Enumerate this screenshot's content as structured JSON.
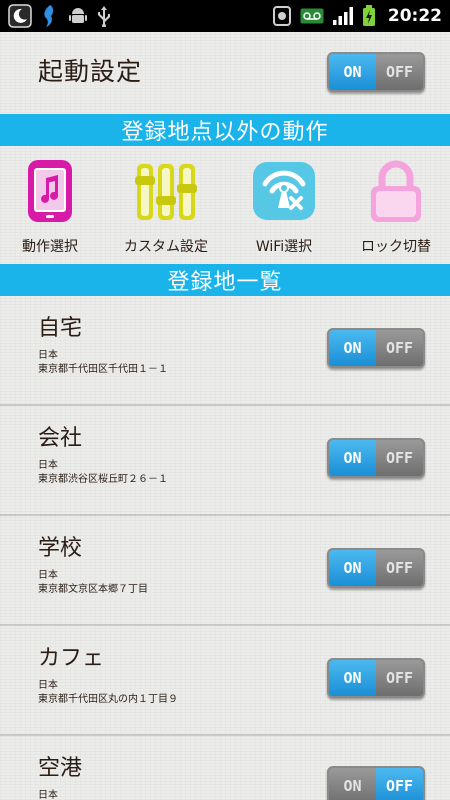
{
  "status_bar": {
    "time": "20:22",
    "left_icons": [
      "moon-app-icon",
      "bird-app-icon",
      "android-icon",
      "usb-icon"
    ],
    "right_icons": [
      "antivirus-icon",
      "voicemail-icon",
      "signal-icon",
      "battery-icon"
    ]
  },
  "startup": {
    "label": "起動設定",
    "toggle": {
      "on_label": "ON",
      "off_label": "OFF",
      "state": "on"
    }
  },
  "section_outside": {
    "title": "登録地点以外の動作"
  },
  "actions": [
    {
      "label": "動作選択",
      "icon": "phone-music-icon",
      "color": "#d81aa8"
    },
    {
      "label": "カスタム設定",
      "icon": "sliders-icon",
      "color": "#d8d81a"
    },
    {
      "label": "WiFi選択",
      "icon": "wifi-off-icon",
      "color": "#56c8e6"
    },
    {
      "label": "ロック切替",
      "icon": "lock-icon",
      "color": "#f5a3dc"
    }
  ],
  "section_list": {
    "title": "登録地一覧"
  },
  "locations": [
    {
      "name": "自宅",
      "country": "日本",
      "address": "東京都千代田区千代田１－１",
      "toggle": {
        "on_label": "ON",
        "off_label": "OFF",
        "state": "on"
      }
    },
    {
      "name": "会社",
      "country": "日本",
      "address": "東京都渋谷区桜丘町２６－１",
      "toggle": {
        "on_label": "ON",
        "off_label": "OFF",
        "state": "on"
      }
    },
    {
      "name": "学校",
      "country": "日本",
      "address": "東京都文京区本郷７丁目",
      "toggle": {
        "on_label": "ON",
        "off_label": "OFF",
        "state": "on"
      }
    },
    {
      "name": "カフェ",
      "country": "日本",
      "address": "東京都千代田区丸の内１丁目９",
      "toggle": {
        "on_label": "ON",
        "off_label": "OFF",
        "state": "on"
      }
    },
    {
      "name": "空港",
      "country": "日本",
      "address": "",
      "toggle": {
        "on_label": "ON",
        "off_label": "OFF",
        "state": "off"
      }
    }
  ]
}
